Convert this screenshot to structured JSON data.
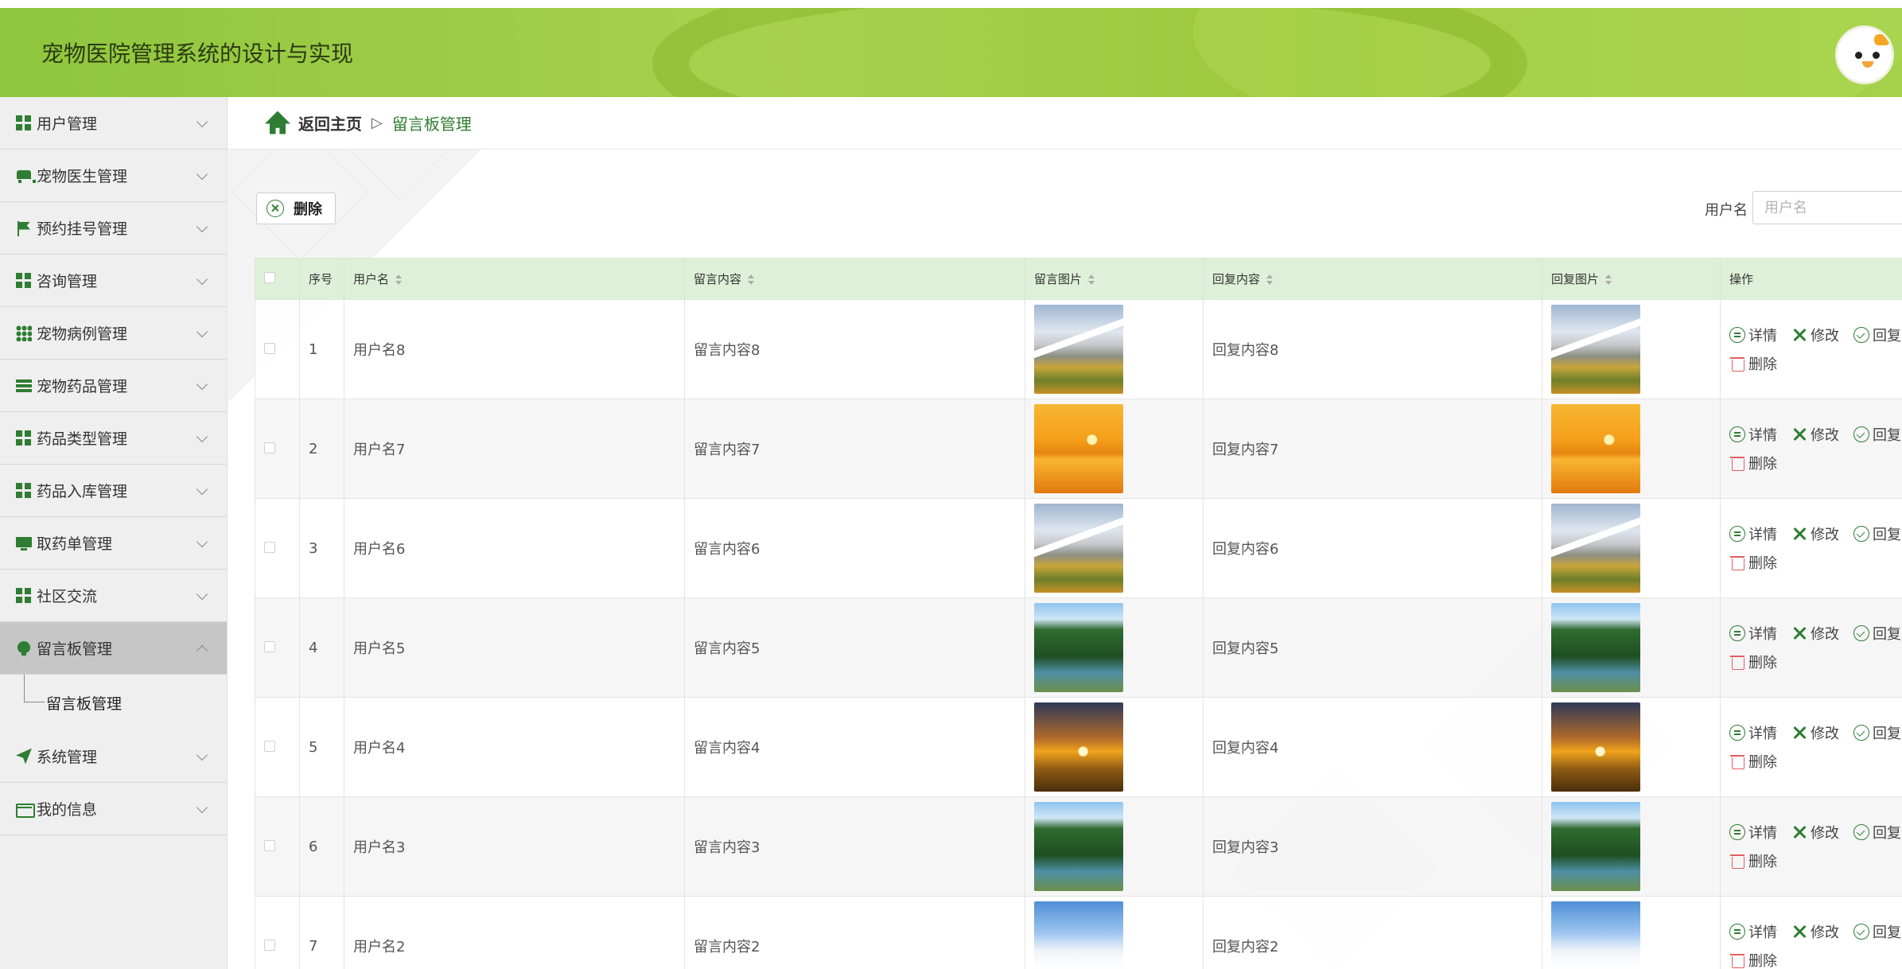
{
  "app": {
    "title": "宠物医院管理系统的设计与实现"
  },
  "sidebar": {
    "items": [
      {
        "label": "用户管理",
        "icon": "grid-icon"
      },
      {
        "label": "宠物医生管理",
        "icon": "bus-icon"
      },
      {
        "label": "预约挂号管理",
        "icon": "flag-icon"
      },
      {
        "label": "咨询管理",
        "icon": "grid-icon"
      },
      {
        "label": "宠物病例管理",
        "icon": "grid9-icon"
      },
      {
        "label": "宠物药品管理",
        "icon": "list-icon"
      },
      {
        "label": "药品类型管理",
        "icon": "grid-icon"
      },
      {
        "label": "药品入库管理",
        "icon": "grid-icon"
      },
      {
        "label": "取药单管理",
        "icon": "monitor-icon"
      },
      {
        "label": "社区交流",
        "icon": "grid-icon"
      },
      {
        "label": "留言板管理",
        "icon": "bulb-icon",
        "active": true
      },
      {
        "label": "系统管理",
        "icon": "plane-icon"
      },
      {
        "label": "我的信息",
        "icon": "card-icon"
      }
    ],
    "submenu_label": "留言板管理"
  },
  "breadcrumb": {
    "home": "返回主页",
    "separator": "▷",
    "current": "留言板管理"
  },
  "toolbar": {
    "delete_label": "删除"
  },
  "search": {
    "label": "用户名",
    "placeholder": "用户名",
    "value": ""
  },
  "table": {
    "headers": {
      "index": "序号",
      "username": "用户名",
      "content": "留言内容",
      "image": "留言图片",
      "reply": "回复内容",
      "reply_image": "回复图片",
      "actions": "操作"
    },
    "action_labels": {
      "detail": "详情",
      "edit": "修改",
      "reply": "回复",
      "delete": "删除"
    },
    "rows": [
      {
        "index": "1",
        "username": "用户名8",
        "content": "留言内容8",
        "reply": "回复内容8",
        "image": "mountain"
      },
      {
        "index": "2",
        "username": "用户名7",
        "content": "留言内容7",
        "reply": "回复内容7",
        "image": "sunset"
      },
      {
        "index": "3",
        "username": "用户名6",
        "content": "留言内容6",
        "reply": "回复内容6",
        "image": "mountain"
      },
      {
        "index": "4",
        "username": "用户名5",
        "content": "留言内容5",
        "reply": "回复内容5",
        "image": "forest"
      },
      {
        "index": "5",
        "username": "用户名4",
        "content": "留言内容4",
        "reply": "回复内容4",
        "image": "grass"
      },
      {
        "index": "6",
        "username": "用户名3",
        "content": "留言内容3",
        "reply": "回复内容3",
        "image": "forest"
      },
      {
        "index": "7",
        "username": "用户名2",
        "content": "留言内容2",
        "reply": "回复内容2",
        "image": "snow"
      }
    ]
  },
  "colors": {
    "accent": "#2e7d32",
    "header_bg": "#a6d14d",
    "table_header_bg": "#dff0d8",
    "danger": "#e35d5d"
  }
}
